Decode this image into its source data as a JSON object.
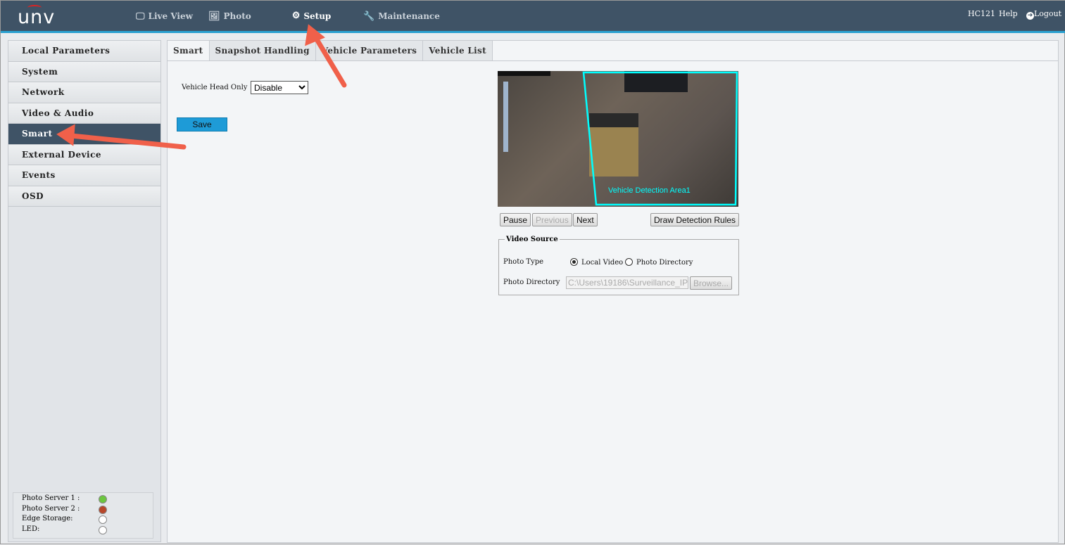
{
  "header": {
    "logo": "UNV",
    "nav": [
      {
        "label": "Live View",
        "icon": "monitor-icon"
      },
      {
        "label": "Photo",
        "icon": "image-icon"
      },
      {
        "label": "Setup",
        "icon": "gear-icon",
        "active": true
      },
      {
        "label": "Maintenance",
        "icon": "wrench-icon"
      }
    ],
    "user": "HC121",
    "help": "Help",
    "logout": "Logout"
  },
  "sidebar": {
    "items": [
      {
        "label": "Local Parameters"
      },
      {
        "label": "System"
      },
      {
        "label": "Network"
      },
      {
        "label": "Video & Audio"
      },
      {
        "label": "Smart",
        "active": true
      },
      {
        "label": "External Device"
      },
      {
        "label": "Events"
      },
      {
        "label": "OSD"
      }
    ],
    "status": [
      {
        "label": "Photo Server 1 :",
        "color": "#6cc63f"
      },
      {
        "label": "Photo Server 2 :",
        "color": "#b8472a"
      },
      {
        "label": "Edge Storage:",
        "color": "#ffffff"
      },
      {
        "label": "LED:",
        "color": "#ffffff"
      }
    ]
  },
  "main": {
    "tabs": [
      {
        "label": "Smart",
        "active": true
      },
      {
        "label": "Snapshot Handling"
      },
      {
        "label": "Vehicle Parameters"
      },
      {
        "label": "Vehicle List"
      }
    ],
    "vehicle_head_only": {
      "label": "Vehicle Head Only",
      "value": "Disable"
    },
    "save": "Save",
    "preview": {
      "area_label": "Vehicle Detection Area1",
      "area_color": "#00ffff"
    },
    "buttons": {
      "pause": "Pause",
      "previous": "Previous",
      "next": "Next",
      "draw": "Draw Detection Rules"
    },
    "video_source": {
      "legend": "Video Source",
      "photo_type_label": "Photo Type",
      "options": [
        "Local Video",
        "Photo Directory"
      ],
      "selected": "Local Video",
      "photo_dir_label": "Photo Directory",
      "photo_dir_value": "C:\\Users\\19186\\Surveillance_IP(",
      "browse": "Browse..."
    }
  }
}
